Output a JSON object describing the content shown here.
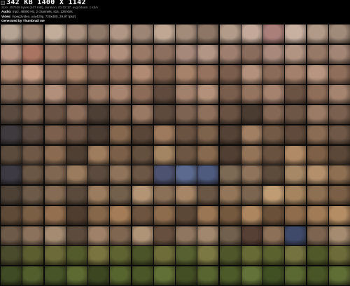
{
  "header": {
    "title": "342 KB 1400 X 1142",
    "file_line": "Size: 457528 bytes (447 KiB), duration: 01:02:17, avg.bitrate: 1 kb/s",
    "audio_label": "Audio:",
    "audio_value": "mp2, 48000 Hz, 2 channels, s16, 128 kb/s",
    "video_label": "Video:",
    "video_value": "mpeg2video, yuv420p, 720x480, 29.97 fps(r)",
    "generated_label": "Generated by Thumbnail me"
  },
  "grid": {
    "columns": 16,
    "rows": 13,
    "thumbnails": [
      "#b5a494",
      "#9a8373",
      "#c2ad9a",
      "#a88f7d",
      "#8e7868",
      "#b09684",
      "#9c8575",
      "#bfa793",
      "#a38b7a",
      "#8d7665",
      "#b29b89",
      "#c4a99a",
      "#aa7f7a",
      "#c9b1a2",
      "#b29a88",
      "#a08a79",
      "#b39180",
      "#a97462",
      "#9b7b68",
      "#8f6c5a",
      "#a58271",
      "#b08f7c",
      "#9a7a67",
      "#8c6f5f",
      "#a5887a",
      "#b39585",
      "#9e7f6f",
      "#8a6c5d",
      "#a7887a",
      "#b29483",
      "#977968",
      "#a28574",
      "#a7826c",
      "#c49a83",
      "#8f705f",
      "#a78168",
      "#6c5547",
      "#8d6d59",
      "#b08a72",
      "#7b5e4c",
      "#a7826a",
      "#94725e",
      "#7a5d4c",
      "#b2907b",
      "#8a6a58",
      "#a3806b",
      "#b79580",
      "#8f6e5b",
      "#7d6555",
      "#8a6e5c",
      "#b28f7a",
      "#6e5444",
      "#9b7a66",
      "#a7846f",
      "#8c6c58",
      "#5f4a3d",
      "#a1806c",
      "#b29079",
      "#7a5e4d",
      "#94735f",
      "#a4826e",
      "#6b5344",
      "#8e6d59",
      "#a4846f",
      "#5a4a3f",
      "#7b6150",
      "#6a5344",
      "#8b6d5a",
      "#4e3f35",
      "#735a49",
      "#9a7964",
      "#5d4a3d",
      "#7d6352",
      "#8f705c",
      "#6a5243",
      "#4b3c32",
      "#846754",
      "#6d5646",
      "#9b7b66",
      "#7a604f",
      "#3f3a3d",
      "#5b4a40",
      "#7c604d",
      "#695243",
      "#4c3d33",
      "#86684f",
      "#5a4638",
      "#9d7a5e",
      "#6b5342",
      "#7d624c",
      "#544236",
      "#a07f63",
      "#735a46",
      "#5f4a3b",
      "#8a6c54",
      "#6f5847",
      "#5b4b3c",
      "#6f5846",
      "#8a6b51",
      "#4f3f33",
      "#9e7c5e",
      "#7b5f48",
      "#64503f",
      "#a38463",
      "#6d5643",
      "#87694f",
      "#523f33",
      "#947459",
      "#6a5241",
      "#b08a66",
      "#7d6047",
      "#5b4839",
      "#3d3a44",
      "#6b5746",
      "#7f6752",
      "#9a7b5e",
      "#5b4a3d",
      "#8f735a",
      "#6c5646",
      "#4d5270",
      "#5c6a8f",
      "#4e5a7e",
      "#7d6a55",
      "#8f735b",
      "#5d4b3c",
      "#a68866",
      "#b38f6c",
      "#8e6f52",
      "#4d4136",
      "#6d5a48",
      "#856b53",
      "#5a4a3b",
      "#9b7c5e",
      "#73604c",
      "#b39575",
      "#8b7058",
      "#a58566",
      "#6a5645",
      "#937659",
      "#7b6550",
      "#c09c74",
      "#a5845f",
      "#8d6f52",
      "#7a5f46",
      "#5f4a37",
      "#7a5f45",
      "#936f50",
      "#4f3d2f",
      "#86674a",
      "#a47d58",
      "#6c5440",
      "#8d6c4e",
      "#5c4837",
      "#9a7654",
      "#75593f",
      "#ad8660",
      "#6a5039",
      "#8e6c4c",
      "#a07b56",
      "#b58d64",
      "#6d5a48",
      "#8a725c",
      "#a48b72",
      "#5d4c3d",
      "#9e8168",
      "#7f6651",
      "#b09478",
      "#664f3e",
      "#8f7660",
      "#a1876d",
      "#71604d",
      "#563f35",
      "#8c7058",
      "#3f4a6a",
      "#7c6450",
      "#a58b70",
      "#4a4a2c",
      "#5c5e30",
      "#6b6a38",
      "#535a2b",
      "#7a7440",
      "#5e6331",
      "#4b5428",
      "#6e6d3a",
      "#566030",
      "#7b7843",
      "#4f572a",
      "#686a36",
      "#5a612f",
      "#747340",
      "#505829",
      "#6c6b39",
      "#3f4b24",
      "#525f2c",
      "#465428",
      "#5d6a32",
      "#3c4722",
      "#56642e",
      "#4a5627",
      "#617036",
      "#434e24",
      "#586530",
      "#4c5a29",
      "#637239",
      "#405023",
      "#5a6831",
      "#485526",
      "#5f6e35"
    ]
  }
}
